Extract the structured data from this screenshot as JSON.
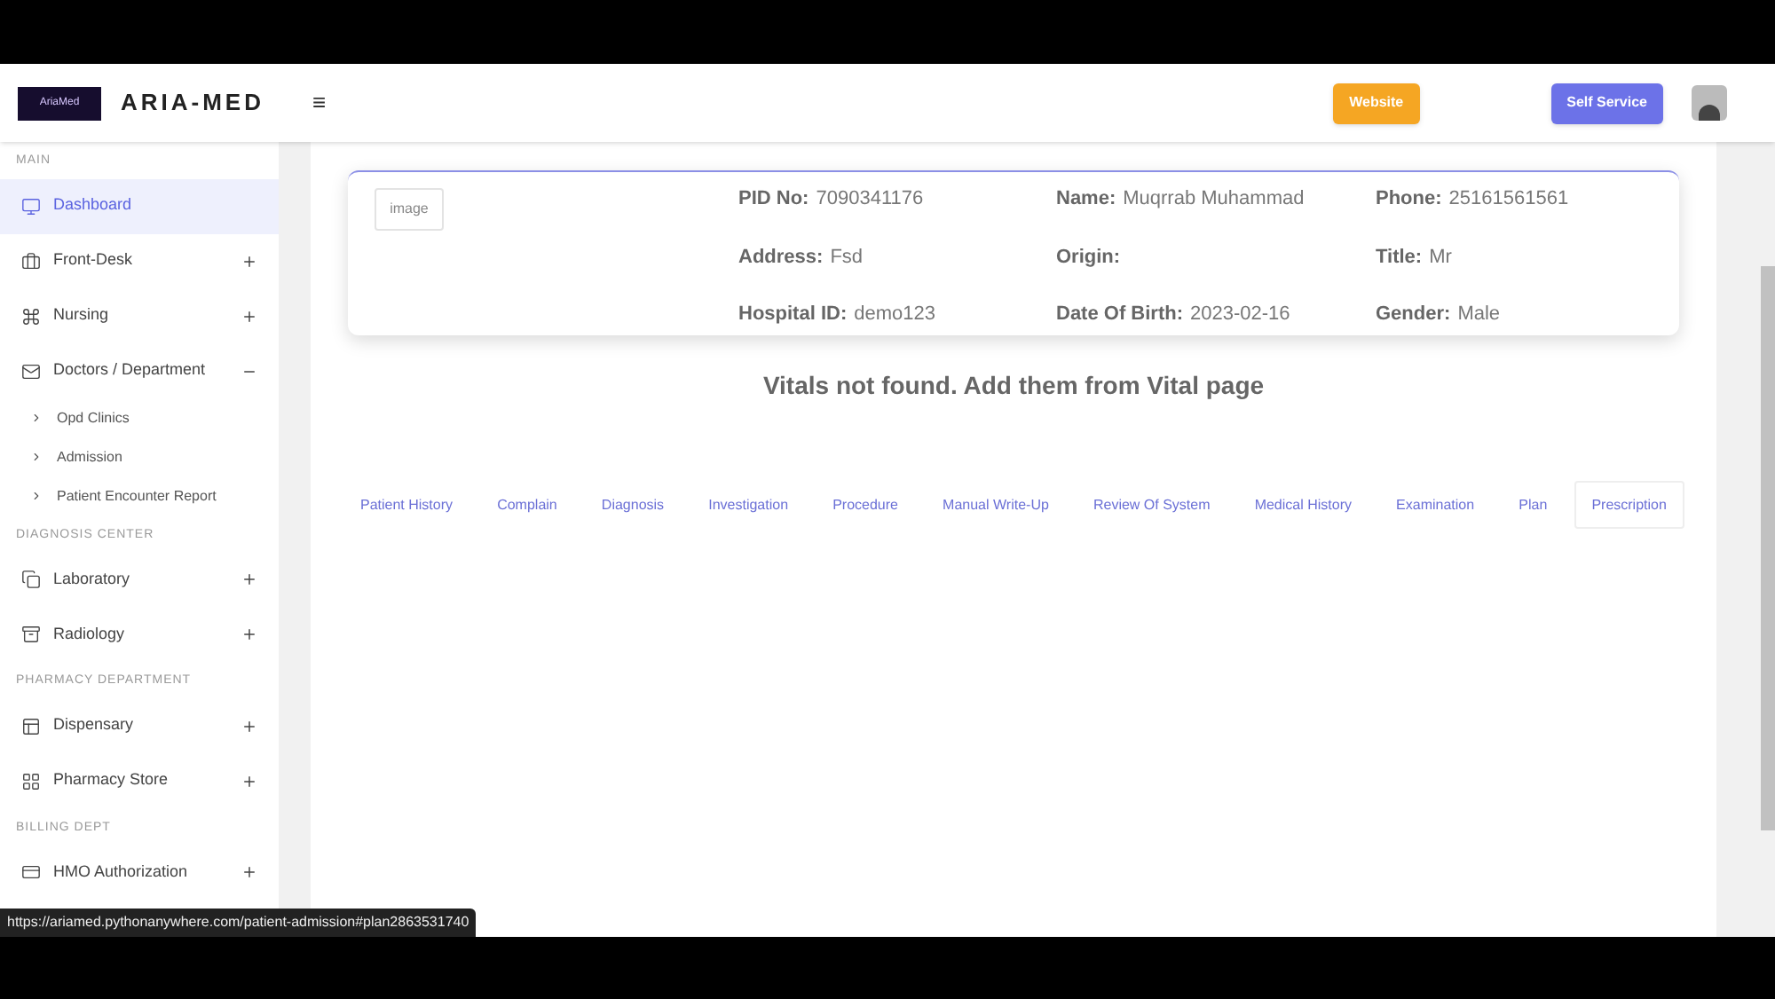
{
  "header": {
    "brand": "ARIA-MED",
    "logo_text": "AriaMed",
    "menu_glyph": "≡",
    "buttons": [
      {
        "label": "Website",
        "kind": "orange"
      },
      {
        "label": "Self Service",
        "kind": "indigo"
      }
    ]
  },
  "sidebar": {
    "sections": [
      {
        "title": "MAIN",
        "items": [
          {
            "label": "Dashboard",
            "selected": true
          },
          {
            "label": "Front-Desk",
            "selected": false,
            "expanded": false
          },
          {
            "label": "Nursing",
            "selected": false,
            "expanded": false
          },
          {
            "label": "Doctors / Department",
            "selected": false,
            "expanded": true,
            "children": [
              {
                "label": "Opd Clinics"
              },
              {
                "label": "Admission"
              },
              {
                "label": "Patient Encounter Report"
              }
            ]
          }
        ]
      },
      {
        "title": "DIAGNOSIS CENTER",
        "items": [
          {
            "label": "Laboratory",
            "selected": false,
            "expanded": false
          },
          {
            "label": "Radiology",
            "selected": false,
            "expanded": false
          }
        ]
      },
      {
        "title": "PHARMACY DEPARTMENT",
        "items": [
          {
            "label": "Dispensary",
            "selected": false,
            "expanded": false
          },
          {
            "label": "Pharmacy Store",
            "selected": false,
            "expanded": false
          }
        ]
      },
      {
        "title": "BILLING DEPT",
        "items": [
          {
            "label": "HMO Authorization",
            "selected": false,
            "expanded": false
          }
        ]
      }
    ]
  },
  "patient": {
    "image_alt": "image",
    "fields": [
      {
        "label": "PID No:",
        "value": "7090341176"
      },
      {
        "label": "Name:",
        "value": "Muqrrab Muhammad"
      },
      {
        "label": "Phone:",
        "value": "25161561561"
      },
      {
        "label": "Address:",
        "value": "Fsd"
      },
      {
        "label": "Origin:"
      },
      {
        "label": "Title:",
        "value": "Mr"
      },
      {
        "label": "Hospital ID:",
        "value": "demo123"
      },
      {
        "label": "Date Of Birth:",
        "value": "2023-02-16"
      },
      {
        "label": "Gender:",
        "value": "Male"
      }
    ]
  },
  "message": "Vitals not found. Add them from Vital page",
  "tabs": [
    {
      "label": "Patient History",
      "selected": false
    },
    {
      "label": "Complain",
      "selected": false
    },
    {
      "label": "Diagnosis",
      "selected": false
    },
    {
      "label": "Investigation",
      "selected": false
    },
    {
      "label": "Procedure",
      "selected": false
    },
    {
      "label": "Manual Write-Up",
      "selected": false
    },
    {
      "label": "Review Of System",
      "selected": false
    },
    {
      "label": "Medical History",
      "selected": false
    },
    {
      "label": "Examination",
      "selected": false
    },
    {
      "label": "Plan",
      "selected": false
    },
    {
      "label": "Prescription",
      "selected": true
    }
  ],
  "status_url": "https://ariamed.pythonanywhere.com/patient-admission#plan2863531740"
}
